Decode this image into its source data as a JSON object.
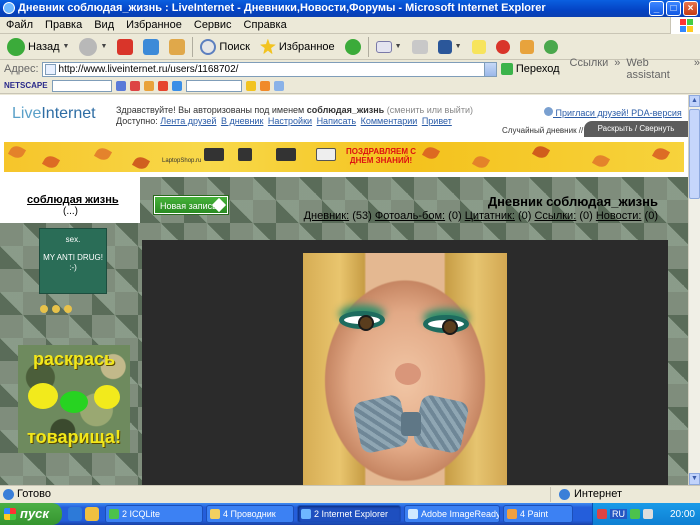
{
  "window": {
    "title": "Дневник соблюдая_жизнь : LiveInternet - Дневники,Новости,Форумы - Microsoft Internet Explorer",
    "minimize": "_",
    "maximize": "□",
    "close": "×"
  },
  "menu": {
    "items": [
      "Файл",
      "Правка",
      "Вид",
      "Избранное",
      "Сервис",
      "Справка"
    ]
  },
  "toolbar": {
    "back_label": "Назад",
    "search_label": "Поиск",
    "favorites_label": "Избранное"
  },
  "address": {
    "label": "Адрес:",
    "url": "http://www.liveinternet.ru/users/1168702/",
    "go_label": "Переход",
    "links_label": "Ссылки",
    "web_assistant": "Web assistant"
  },
  "linksbar": {
    "netscape": "NETSCAPE"
  },
  "liveinternet": {
    "logo_live": "Live",
    "logo_internet": "Internet",
    "welcome_prefix": "Здравствуйте! Вы авторизованы под именем",
    "username": "соблюдая_жизнь",
    "welcome_suffix": "(сменить или выйти)",
    "available_label": "Доступно:",
    "links": [
      "Лента друзей",
      "В дневник",
      "Настройки",
      "Написать",
      "Комментарии",
      "Привет"
    ],
    "invite": "Пригласи друзей!",
    "pda": "PDA-версия",
    "random_diary": "Случайный дневник //",
    "expand": "Раскрыть / Свернуть"
  },
  "banner": {
    "shop": "LaptopShop.ru",
    "promo_line1": "ПОЗДРАВЛЯЕМ С",
    "promo_line2": "ДНЕМ ЗНАНИЙ!"
  },
  "diary": {
    "blog_name": "соблюдая жизнь",
    "blog_name_sub": "(...)",
    "avatar_line1": "sex.",
    "avatar_line2": "MY ANTI DRUG! :-)",
    "sticker_top": "раскрась",
    "sticker_bottom": "товарища!",
    "new_post": "Новая запись",
    "title": "Дневник соблюдая_жизнь",
    "stats": {
      "diary_label": "Дневник:",
      "diary_count": "(53)",
      "photo_label": "Фотоаль-бом:",
      "photo_count": "(0)",
      "quotes_label": "Цитатник:",
      "quotes_count": "(0)",
      "links_label": "Ссылки:",
      "links_count": "(0)",
      "news_label": "Новости:",
      "news_count": "(0)"
    }
  },
  "status": {
    "text": "Готово",
    "zone": "Интернет"
  },
  "taskbar": {
    "start": "пуск",
    "tasks": [
      "2 ICQLite",
      "4 Проводник",
      "2 Internet Explorer",
      "Adobe ImageReady...",
      "4 Paint"
    ],
    "lang": "RU",
    "clock": "20:00"
  },
  "colors": {
    "xp_blue": "#245edb",
    "start_green": "#35952f",
    "link_blue": "#2b5ca7",
    "new_post_green": "#2a8a22",
    "banner_yellow": "#f6c52a"
  }
}
